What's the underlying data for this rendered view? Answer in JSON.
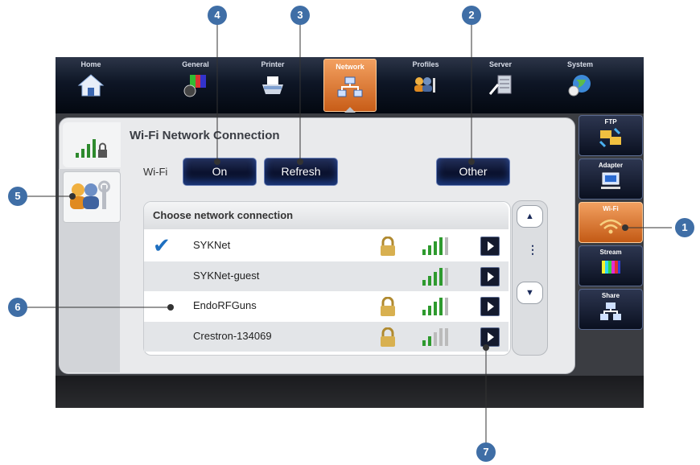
{
  "nav": {
    "tabs": [
      {
        "label": "Home",
        "icon": "home-icon"
      },
      {
        "label": "General",
        "icon": "general-icon"
      },
      {
        "label": "Printer",
        "icon": "printer-icon"
      },
      {
        "label": "Network",
        "icon": "network-icon",
        "active": true
      },
      {
        "label": "Profiles",
        "icon": "profiles-icon"
      },
      {
        "label": "Server",
        "icon": "server-icon"
      },
      {
        "label": "System",
        "icon": "system-icon"
      }
    ]
  },
  "panel": {
    "title": "Wi-Fi Network Connection",
    "wifi_label": "Wi-Fi",
    "buttons": {
      "on": "On",
      "refresh": "Refresh",
      "other": "Other"
    }
  },
  "list": {
    "header": "Choose network connection",
    "networks": [
      {
        "name": "SYKNet",
        "connected": true,
        "locked": true,
        "signal_bars": 4
      },
      {
        "name": "SYKNet-guest",
        "connected": false,
        "locked": false,
        "signal_bars": 4
      },
      {
        "name": "EndoRFGuns",
        "connected": false,
        "locked": true,
        "signal_bars": 4
      },
      {
        "name": "Crestron-134069",
        "connected": false,
        "locked": true,
        "signal_bars": 2
      }
    ]
  },
  "scrollbar": {
    "up": "▲",
    "middle": "⋮",
    "down": "▼"
  },
  "side_tabs": [
    {
      "label": "FTP",
      "icon": "ftp-icon"
    },
    {
      "label": "Adapter",
      "icon": "adapter-icon"
    },
    {
      "label": "Wi-Fi",
      "icon": "wifi-icon",
      "active": true
    },
    {
      "label": "Stream",
      "icon": "stream-icon"
    },
    {
      "label": "Share",
      "icon": "share-icon"
    }
  ],
  "callouts": [
    "1",
    "2",
    "3",
    "4",
    "5",
    "6",
    "7"
  ],
  "colors": {
    "accent": "#e07a30",
    "callout": "#3f6ea6",
    "button": "#0c1330",
    "checkmark": "#1e6fc0"
  }
}
